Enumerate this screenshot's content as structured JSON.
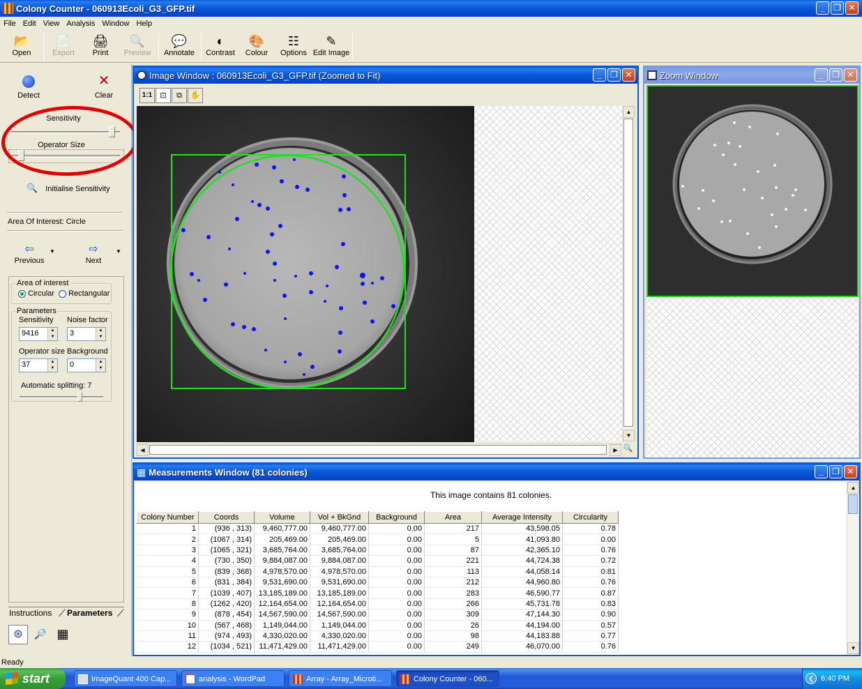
{
  "app": {
    "title": "Colony Counter - 060913Ecoli_G3_GFP.tif",
    "menu": [
      "File",
      "Edit",
      "View",
      "Analysis",
      "Window",
      "Help"
    ]
  },
  "toolbar": {
    "open": "Open",
    "export": "Export",
    "print": "Print",
    "preview": "Preview",
    "annotate": "Annotate",
    "contrast": "Contrast",
    "colour": "Colour",
    "options": "Options",
    "edit_image": "Edit Image"
  },
  "left": {
    "detect": "Detect",
    "clear": "Clear",
    "sensitivity_label": "Sensitivity",
    "sensitivity_level": 0.95,
    "operator_size_label": "Operator Size",
    "operator_size_level": 0.07,
    "initialise": "Initialise Sensitivity",
    "area_of_interest": "Area Of Interest:  Circle",
    "previous": "Previous",
    "next": "Next",
    "aoi_group": "Area of interest",
    "circular": "Circular",
    "rectangular": "Rectangular",
    "params_group": "Parameters",
    "sens_field_label": "Sensitivity",
    "sens_value": "9416",
    "noise_label": "Noise factor",
    "noise_value": "3",
    "opsize_label": "Operator size",
    "opsize_value": "37",
    "background_label": "Background",
    "background_value": "0",
    "auto_split": "Automatic splitting:  7",
    "auto_split_level": 0.75,
    "tab_instructions": "Instructions",
    "tab_parameters": "Parameters"
  },
  "image_window": {
    "title": "Image Window : 060913Ecoli_G3_GFP.tif (Zoomed to Fit)",
    "one_to_one": "1:1"
  },
  "zoom_window": {
    "title": "Zoom Window"
  },
  "measurements": {
    "title": "Measurements Window (81 colonies)",
    "summary": "This image contains 81 colonies.",
    "columns": [
      "Colony Number",
      "Coords",
      "Volume",
      "Vol + BkGnd",
      "Background",
      "Area",
      "Average Intensity",
      "Circularity"
    ],
    "rows": [
      [
        "1",
        "(936 , 313)",
        "9,460,777.00",
        "9,460,777.00",
        "0.00",
        "217",
        "43,598.05",
        "0.78"
      ],
      [
        "2",
        "(1067 , 314)",
        "205,469.00",
        "205,469.00",
        "0.00",
        "5",
        "41,093.80",
        "0.00"
      ],
      [
        "3",
        "(1065 , 321)",
        "3,685,764.00",
        "3,685,764.00",
        "0.00",
        "87",
        "42,365.10",
        "0.76"
      ],
      [
        "4",
        "(730 , 350)",
        "9,884,087.00",
        "9,884,087.00",
        "0.00",
        "221",
        "44,724.38",
        "0.72"
      ],
      [
        "5",
        "(839 , 368)",
        "4,978,570.00",
        "4,978,570.00",
        "0.00",
        "113",
        "44,058.14",
        "0.81"
      ],
      [
        "6",
        "(831 , 384)",
        "9,531,690.00",
        "9,531,690.00",
        "0.00",
        "212",
        "44,960.80",
        "0.76"
      ],
      [
        "7",
        "(1039 , 407)",
        "13,185,189.00",
        "13,185,189.00",
        "0.00",
        "283",
        "46,590.77",
        "0.87"
      ],
      [
        "8",
        "(1262 , 420)",
        "12,164,654.00",
        "12,164,654.00",
        "0.00",
        "266",
        "45,731.78",
        "0.83"
      ],
      [
        "9",
        "(878 , 454)",
        "14,567,590.00",
        "14,567,590.00",
        "0.00",
        "309",
        "47,144.30",
        "0.90"
      ],
      [
        "10",
        "(567 , 468)",
        "1,149,044.00",
        "1,149,044.00",
        "0.00",
        "26",
        "44,194.00",
        "0.57"
      ],
      [
        "11",
        "(974 , 493)",
        "4,330,020.00",
        "4,330,020.00",
        "0.00",
        "98",
        "44,183.88",
        "0.77"
      ],
      [
        "12",
        "(1034 , 521)",
        "11,471,429.00",
        "11,471,429.00",
        "0.00",
        "249",
        "46,070.00",
        "0.76"
      ]
    ]
  },
  "status": {
    "text": "Ready"
  },
  "taskbar": {
    "start": "start",
    "tasks": [
      "ImageQuant 400 Cap...",
      "analysis - WordPad",
      "Array - Array_Microti...",
      "Colony Counter - 060..."
    ],
    "clock": "6:40 PM"
  }
}
